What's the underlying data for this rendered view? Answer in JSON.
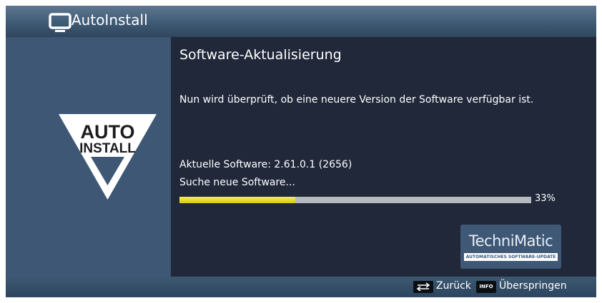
{
  "header": {
    "title": "AutoInstall",
    "icon": "tv-icon"
  },
  "sidebar": {
    "logo_line1": "AUTO",
    "logo_line2": "INSTALL"
  },
  "main": {
    "heading": "Software-Aktualisierung",
    "message": "Nun wird überprüft, ob eine neuere Version der Software verfügbar ist.",
    "current_software": "Aktuelle Software: 2.61.0.1 (2656)",
    "search_status": "Suche neue Software...",
    "progress": {
      "value": 0.33,
      "label": "33%"
    }
  },
  "brand": {
    "name": "TechniMatic",
    "tagline": "AUTOMATISCHES SOFTWARE-UPDATE"
  },
  "footer": {
    "back_label": "Zurück",
    "info_key": "INFO",
    "skip_label": "Überspringen"
  },
  "colors": {
    "accent_yellow": "#e6dc2a",
    "panel_blue": "#3d5774",
    "background": "#20283a"
  }
}
